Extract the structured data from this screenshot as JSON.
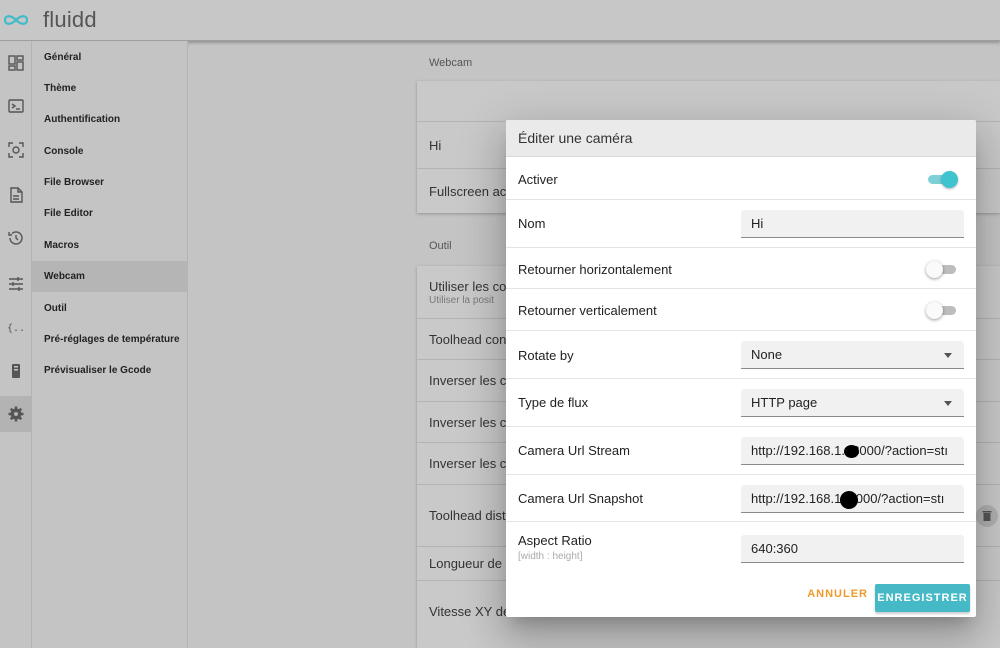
{
  "app": {
    "title": "fluidd"
  },
  "rail": [
    "dashboard-icon",
    "console-icon",
    "printer-camera-icon",
    "file-icon",
    "history-icon",
    "tune-icon",
    "macros-icon",
    "device-icon",
    "settings-icon"
  ],
  "settings_nav": [
    "Général",
    "Thème",
    "Authentification",
    "Console",
    "File Browser",
    "File Editor",
    "Macros",
    "Webcam",
    "Outil",
    "Pré-réglages de température",
    "Prévisualiser le Gcode"
  ],
  "settings_nav_active": "Webcam",
  "background": {
    "webcam_section": "Webcam",
    "webcam_rows": [
      "Hi",
      "Fullscreen act"
    ],
    "outil_section": "Outil",
    "outil_rows": [
      {
        "title": "Utiliser les co",
        "sub": "Utiliser la posit"
      },
      {
        "title": "Toolhead con"
      },
      {
        "title": "Inverser les co"
      },
      {
        "title": "Inverser les co"
      },
      {
        "title": "Inverser les co"
      },
      {
        "title": "Toolhead dist"
      },
      {
        "title": "Longueur de c"
      },
      {
        "title": "Vitesse XY de"
      }
    ]
  },
  "dialog": {
    "title": "Éditer une caméra",
    "enable_label": "Activer",
    "enable_on": true,
    "name_label": "Nom",
    "name_value": "Hi",
    "flip_h_label": "Retourner horizontalement",
    "flip_h_on": false,
    "flip_v_label": "Retourner verticalement",
    "flip_v_on": false,
    "rotate_label": "Rotate by",
    "rotate_value": "None",
    "stream_type_label": "Type de flux",
    "stream_type_value": "HTTP page",
    "url_stream_label": "Camera Url Stream",
    "url_stream_value": "http://192.168.1.   :8000/?action=stı",
    "url_snapshot_label": "Camera Url Snapshot",
    "url_snapshot_value": "http://192.168.1    :8000/?action=stı",
    "aspect_label": "Aspect Ratio",
    "aspect_hint": "[width : height]",
    "aspect_value": "640:360",
    "cancel_label": "ANNULER",
    "save_label": "ENREGISTRER"
  },
  "colors": {
    "accent": "#45b9c6",
    "toggle_on": "#3ec3cf",
    "cancel": "#ef9a2c"
  }
}
